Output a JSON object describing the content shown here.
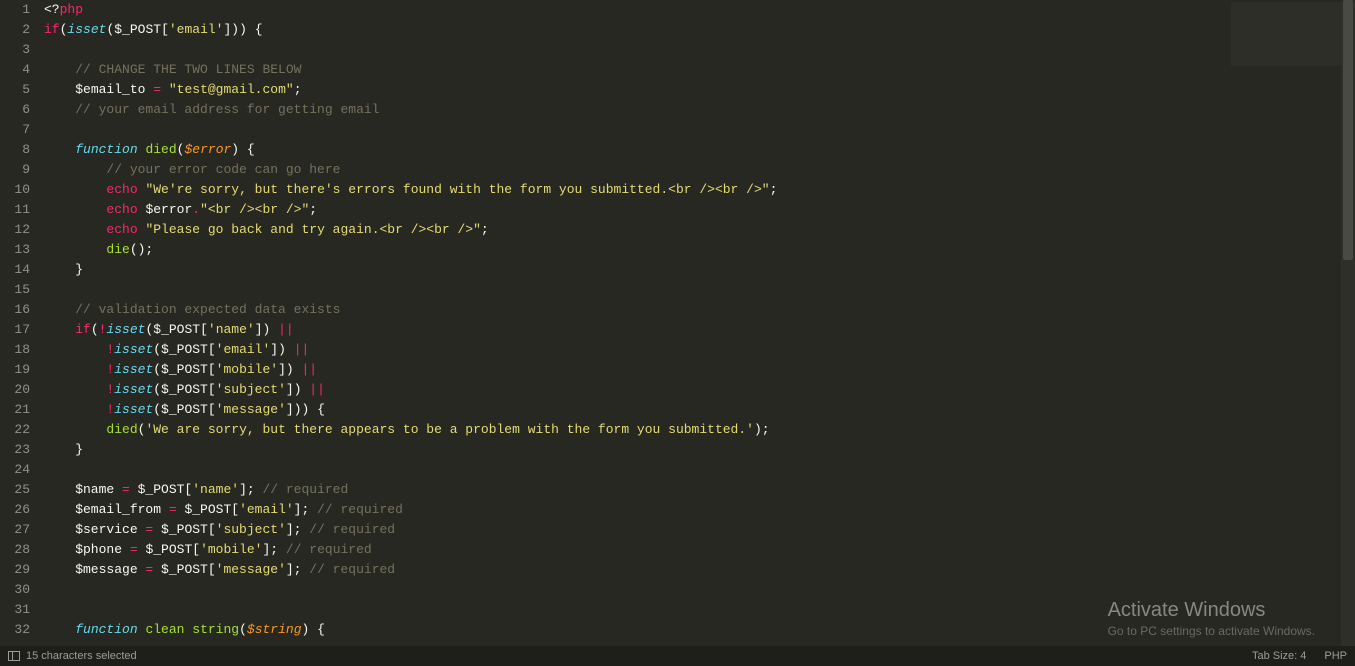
{
  "editor": {
    "language": "PHP",
    "tab_size_label": "Tab Size: 4",
    "selection_status": "15 characters selected",
    "first_line": 1,
    "line_count": 32,
    "tokens": [
      [
        [
          "plain",
          "<?"
        ],
        [
          "kw",
          "php"
        ]
      ],
      [
        [
          "kw",
          "if"
        ],
        [
          "plain",
          "("
        ],
        [
          "fn",
          "isset"
        ],
        [
          "plain",
          "("
        ],
        [
          "plain",
          "$_POST"
        ],
        [
          "plain",
          "["
        ],
        [
          "str",
          "'email'"
        ],
        [
          "plain",
          "])) {"
        ]
      ],
      [],
      [
        [
          "plain",
          "    "
        ],
        [
          "cmt",
          "// CHANGE THE TWO LINES BELOW"
        ]
      ],
      [
        [
          "plain",
          "    "
        ],
        [
          "plain",
          "$email_to "
        ],
        [
          "op",
          "="
        ],
        [
          "plain",
          " "
        ],
        [
          "str",
          "\"test@gmail.com\""
        ],
        [
          "plain",
          ";"
        ]
      ],
      [
        [
          "plain",
          "    "
        ],
        [
          "cmt",
          "// your email address for getting email"
        ]
      ],
      [],
      [
        [
          "plain",
          "    "
        ],
        [
          "fn",
          "function"
        ],
        [
          "plain",
          " "
        ],
        [
          "name",
          "died"
        ],
        [
          "plain",
          "("
        ],
        [
          "var",
          "$error"
        ],
        [
          "plain",
          ") {"
        ]
      ],
      [
        [
          "plain",
          "        "
        ],
        [
          "cmt",
          "// your error code can go here"
        ]
      ],
      [
        [
          "plain",
          "        "
        ],
        [
          "kw",
          "echo"
        ],
        [
          "plain",
          " "
        ],
        [
          "str",
          "\"We're sorry, but there's errors found with the form you submitted.<br /><br />\""
        ],
        [
          "plain",
          ";"
        ]
      ],
      [
        [
          "plain",
          "        "
        ],
        [
          "kw",
          "echo"
        ],
        [
          "plain",
          " $error"
        ],
        [
          "op",
          "."
        ],
        [
          "str",
          "\"<br /><br />\""
        ],
        [
          "plain",
          ";"
        ]
      ],
      [
        [
          "plain",
          "        "
        ],
        [
          "kw",
          "echo"
        ],
        [
          "plain",
          " "
        ],
        [
          "str",
          "\"Please go back and try again.<br /><br />\""
        ],
        [
          "plain",
          ";"
        ]
      ],
      [
        [
          "plain",
          "        "
        ],
        [
          "name",
          "die"
        ],
        [
          "plain",
          "();"
        ]
      ],
      [
        [
          "plain",
          "    }"
        ]
      ],
      [],
      [
        [
          "plain",
          "    "
        ],
        [
          "cmt",
          "// validation expected data exists"
        ]
      ],
      [
        [
          "plain",
          "    "
        ],
        [
          "kw",
          "if"
        ],
        [
          "plain",
          "("
        ],
        [
          "op",
          "!"
        ],
        [
          "fn",
          "isset"
        ],
        [
          "plain",
          "($_POST["
        ],
        [
          "str",
          "'name'"
        ],
        [
          "plain",
          "]) "
        ],
        [
          "op",
          "||"
        ]
      ],
      [
        [
          "plain",
          "        "
        ],
        [
          "op",
          "!"
        ],
        [
          "fn",
          "isset"
        ],
        [
          "plain",
          "($_POST["
        ],
        [
          "str",
          "'email'"
        ],
        [
          "plain",
          "]) "
        ],
        [
          "op",
          "||"
        ]
      ],
      [
        [
          "plain",
          "        "
        ],
        [
          "op",
          "!"
        ],
        [
          "fn",
          "isset"
        ],
        [
          "plain",
          "($_POST["
        ],
        [
          "str",
          "'mobile'"
        ],
        [
          "plain",
          "]) "
        ],
        [
          "op",
          "||"
        ]
      ],
      [
        [
          "plain",
          "        "
        ],
        [
          "op",
          "!"
        ],
        [
          "fn",
          "isset"
        ],
        [
          "plain",
          "($_POST["
        ],
        [
          "str",
          "'subject'"
        ],
        [
          "plain",
          "]) "
        ],
        [
          "op",
          "||"
        ]
      ],
      [
        [
          "plain",
          "        "
        ],
        [
          "op",
          "!"
        ],
        [
          "fn",
          "isset"
        ],
        [
          "plain",
          "($_POST["
        ],
        [
          "str",
          "'message'"
        ],
        [
          "plain",
          "])) {"
        ]
      ],
      [
        [
          "plain",
          "        "
        ],
        [
          "name",
          "died"
        ],
        [
          "plain",
          "("
        ],
        [
          "str",
          "'We are sorry, but there appears to be a problem with the form you submitted.'"
        ],
        [
          "plain",
          ");"
        ]
      ],
      [
        [
          "plain",
          "    }"
        ]
      ],
      [],
      [
        [
          "plain",
          "    $name "
        ],
        [
          "op",
          "="
        ],
        [
          "plain",
          " $_POST["
        ],
        [
          "str",
          "'name'"
        ],
        [
          "plain",
          "]; "
        ],
        [
          "cmt",
          "// required"
        ]
      ],
      [
        [
          "plain",
          "    $email_from "
        ],
        [
          "op",
          "="
        ],
        [
          "plain",
          " $_POST["
        ],
        [
          "str",
          "'email'"
        ],
        [
          "plain",
          "]; "
        ],
        [
          "cmt",
          "// required"
        ]
      ],
      [
        [
          "plain",
          "    $service "
        ],
        [
          "op",
          "="
        ],
        [
          "plain",
          " $_POST["
        ],
        [
          "str",
          "'subject'"
        ],
        [
          "plain",
          "]; "
        ],
        [
          "cmt",
          "// required"
        ]
      ],
      [
        [
          "plain",
          "    $phone "
        ],
        [
          "op",
          "="
        ],
        [
          "plain",
          " $_POST["
        ],
        [
          "str",
          "'mobile'"
        ],
        [
          "plain",
          "]; "
        ],
        [
          "cmt",
          "// required"
        ]
      ],
      [
        [
          "plain",
          "    $message "
        ],
        [
          "op",
          "="
        ],
        [
          "plain",
          " $_POST["
        ],
        [
          "str",
          "'message'"
        ],
        [
          "plain",
          "]; "
        ],
        [
          "cmt",
          "// required"
        ]
      ],
      [],
      [],
      [
        [
          "plain",
          "    "
        ],
        [
          "fn",
          "function"
        ],
        [
          "plain",
          " "
        ],
        [
          "name",
          "clean"
        ],
        [
          "plain",
          " "
        ],
        [
          "name",
          "string"
        ],
        [
          "plain",
          "("
        ],
        [
          "var",
          "$string"
        ],
        [
          "plain",
          ") {"
        ]
      ]
    ]
  },
  "watermark": {
    "title": "Activate Windows",
    "subtitle": "Go to PC settings to activate Windows."
  }
}
